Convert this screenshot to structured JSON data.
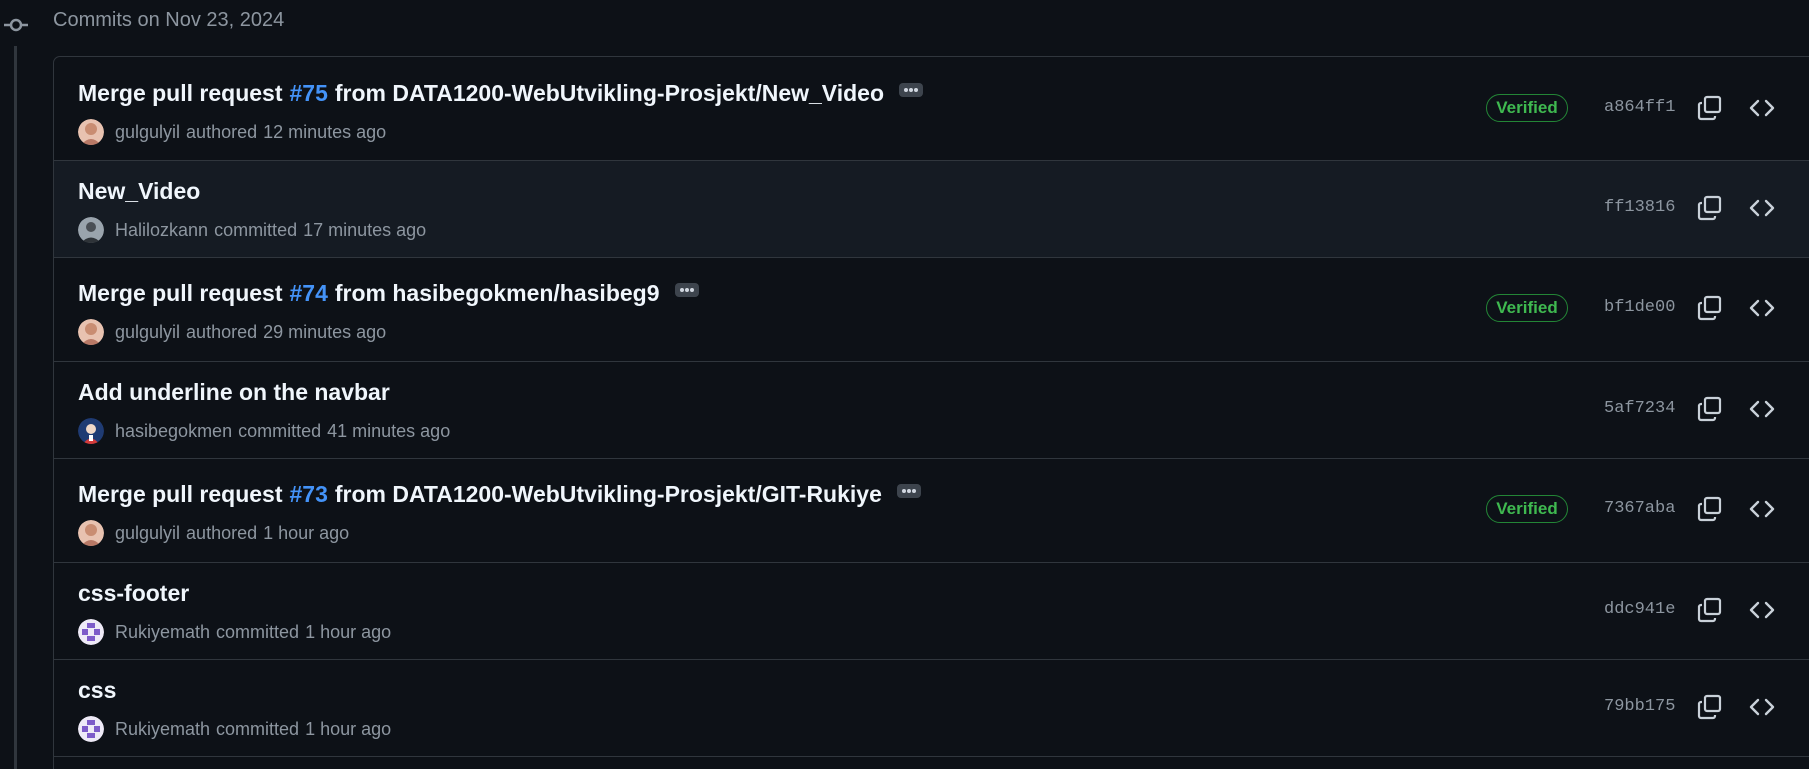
{
  "group": {
    "header": "Commits on Nov 23, 2024"
  },
  "commits": [
    {
      "title_prefix": "Merge pull request",
      "pr_link": "#75",
      "title_suffix": "from DATA1200-WebUtvikling-Prosjekt/New_Video",
      "title": "",
      "author": "gulgulyil",
      "action": "authored",
      "time": "12 minutes ago",
      "verified": "Verified",
      "sha": "a864ff1"
    },
    {
      "title_prefix": "",
      "pr_link": "",
      "title_suffix": "",
      "title": "New_Video",
      "author": "Halilozkann",
      "action": "committed",
      "time": "17 minutes ago",
      "verified": "",
      "sha": "ff13816"
    },
    {
      "title_prefix": "Merge pull request",
      "pr_link": "#74",
      "title_suffix": "from hasibegokmen/hasibeg9",
      "title": "",
      "author": "gulgulyil",
      "action": "authored",
      "time": "29 minutes ago",
      "verified": "Verified",
      "sha": "bf1de00"
    },
    {
      "title_prefix": "",
      "pr_link": "",
      "title_suffix": "",
      "title": "Add underline on the navbar",
      "author": "hasibegokmen",
      "action": "committed",
      "time": "41 minutes ago",
      "verified": "",
      "sha": "5af7234"
    },
    {
      "title_prefix": "Merge pull request",
      "pr_link": "#73",
      "title_suffix": "from DATA1200-WebUtvikling-Prosjekt/GIT-Rukiye",
      "title": "",
      "author": "gulgulyil",
      "action": "authored",
      "time": "1 hour ago",
      "verified": "Verified",
      "sha": "7367aba"
    },
    {
      "title_prefix": "",
      "pr_link": "",
      "title_suffix": "",
      "title": "css-footer",
      "author": "Rukiyemath",
      "action": "committed",
      "time": "1 hour ago",
      "verified": "",
      "sha": "ddc941e"
    },
    {
      "title_prefix": "",
      "pr_link": "",
      "title_suffix": "",
      "title": "css",
      "author": "Rukiyemath",
      "action": "committed",
      "time": "1 hour ago",
      "verified": "",
      "sha": "79bb175"
    }
  ],
  "icons": {
    "timeline": "git-commit-icon",
    "copy": "copy-icon",
    "browse": "code-icon",
    "more": "kebab-horizontal-icon"
  },
  "colors": {
    "background": "#0d1117",
    "row_alt": "#151b23",
    "border": "#30363d",
    "link": "#4493f8",
    "verified": "#3fb950",
    "muted": "#8d96a0"
  }
}
